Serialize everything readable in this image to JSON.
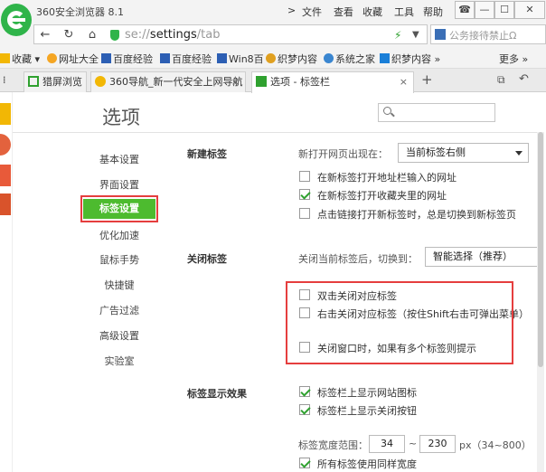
{
  "window": {
    "app_title": "360安全浏览器 8.1",
    "menu": [
      "文件",
      "查看",
      "收藏",
      "工具",
      "帮助"
    ],
    "menu_arrow": ">"
  },
  "nav": {
    "url_prefix": "se://",
    "url_main": "settings",
    "url_suffix": "/tab",
    "search_placeholder": "公务接待禁止Ω"
  },
  "bookmarks": {
    "items": [
      "收藏",
      "网址大全",
      "百度经验",
      "百度经验",
      "Win8百",
      "织梦内容",
      "系统之家",
      "织梦内容"
    ],
    "more": "更多"
  },
  "tabs": [
    {
      "label": "猎屏浏览"
    },
    {
      "label": "360导航_新一代安全上网导航"
    },
    {
      "label": "选项 - 标签栏"
    }
  ],
  "settings": {
    "page_title": "选项",
    "sidebar": [
      "基本设置",
      "界面设置",
      "标签设置",
      "优化加速",
      "鼠标手势",
      "快捷键",
      "广告过滤",
      "高级设置",
      "实验室"
    ],
    "new_tab": {
      "title": "新建标签",
      "position_label": "新打开网页出现在：",
      "position_value": "当前标签右侧",
      "options": [
        {
          "label": "在新标签打开地址栏输入的网址",
          "checked": false
        },
        {
          "label": "在新标签打开收藏夹里的网址",
          "checked": true
        },
        {
          "label": "点击链接打开新标签时，总是切换到新标签页",
          "checked": false
        }
      ]
    },
    "close_tab": {
      "title": "关闭标签",
      "switch_label": "关闭当前标签后，切换到：",
      "switch_value": "智能选择（推荐）",
      "options": [
        {
          "label": "双击关闭对应标签",
          "checked": false
        },
        {
          "label": "右击关闭对应标签（按住Shift右击可弹出菜单）",
          "checked": false
        },
        {
          "label": "关闭窗口时，如果有多个标签则提示",
          "checked": false
        }
      ]
    },
    "display": {
      "title": "标签显示效果",
      "options": [
        {
          "label": "标签栏上显示网站图标",
          "checked": true
        },
        {
          "label": "标签栏上显示关闭按钮",
          "checked": true
        },
        {
          "label": "所有标签使用同样宽度",
          "checked": true
        }
      ],
      "width_label": "标签宽度范围：",
      "width_min": "34",
      "width_sep": "~",
      "width_max": "230",
      "width_unit": "px（34~800）"
    }
  },
  "colors": {
    "brand_green": "#2fb44a",
    "active_green": "#4dbb2f",
    "highlight_red": "#e53e3e"
  }
}
